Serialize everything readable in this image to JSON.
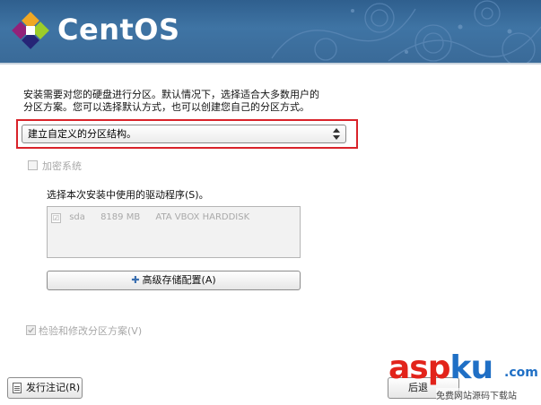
{
  "header": {
    "brand": "CentOS"
  },
  "description": {
    "line1": "安装需要对您的硬盘进行分区。默认情况下，选择适合大多数用户的",
    "line2": "分区方案。您可以选择默认方式，也可以创建您自己的分区方式。"
  },
  "partition_select": {
    "value": "建立自定义的分区结构。"
  },
  "encrypt": {
    "label": "加密系统"
  },
  "drives": {
    "label": "选择本次安装中使用的驱动程序(S)。",
    "rows": [
      {
        "checked": "☑",
        "name": "sda",
        "size": "8189 MB",
        "model": "ATA VBOX HARDDISK"
      }
    ]
  },
  "advanced_button": {
    "label": "高级存储配置(A)"
  },
  "review": {
    "label": "检验和修改分区方案(V)"
  },
  "release_notes_button": {
    "label": "发行注记(R)"
  },
  "next_button": {
    "label": "后退"
  },
  "watermark": {
    "brand_a": "asp",
    "brand_b": "ku",
    "suffix": ".com",
    "tagline": "免费网站源码下载站"
  },
  "colors": {
    "header_blue": "#3a6a98",
    "highlight_red": "#d9232a",
    "accent_blue": "#1f6fc5"
  }
}
